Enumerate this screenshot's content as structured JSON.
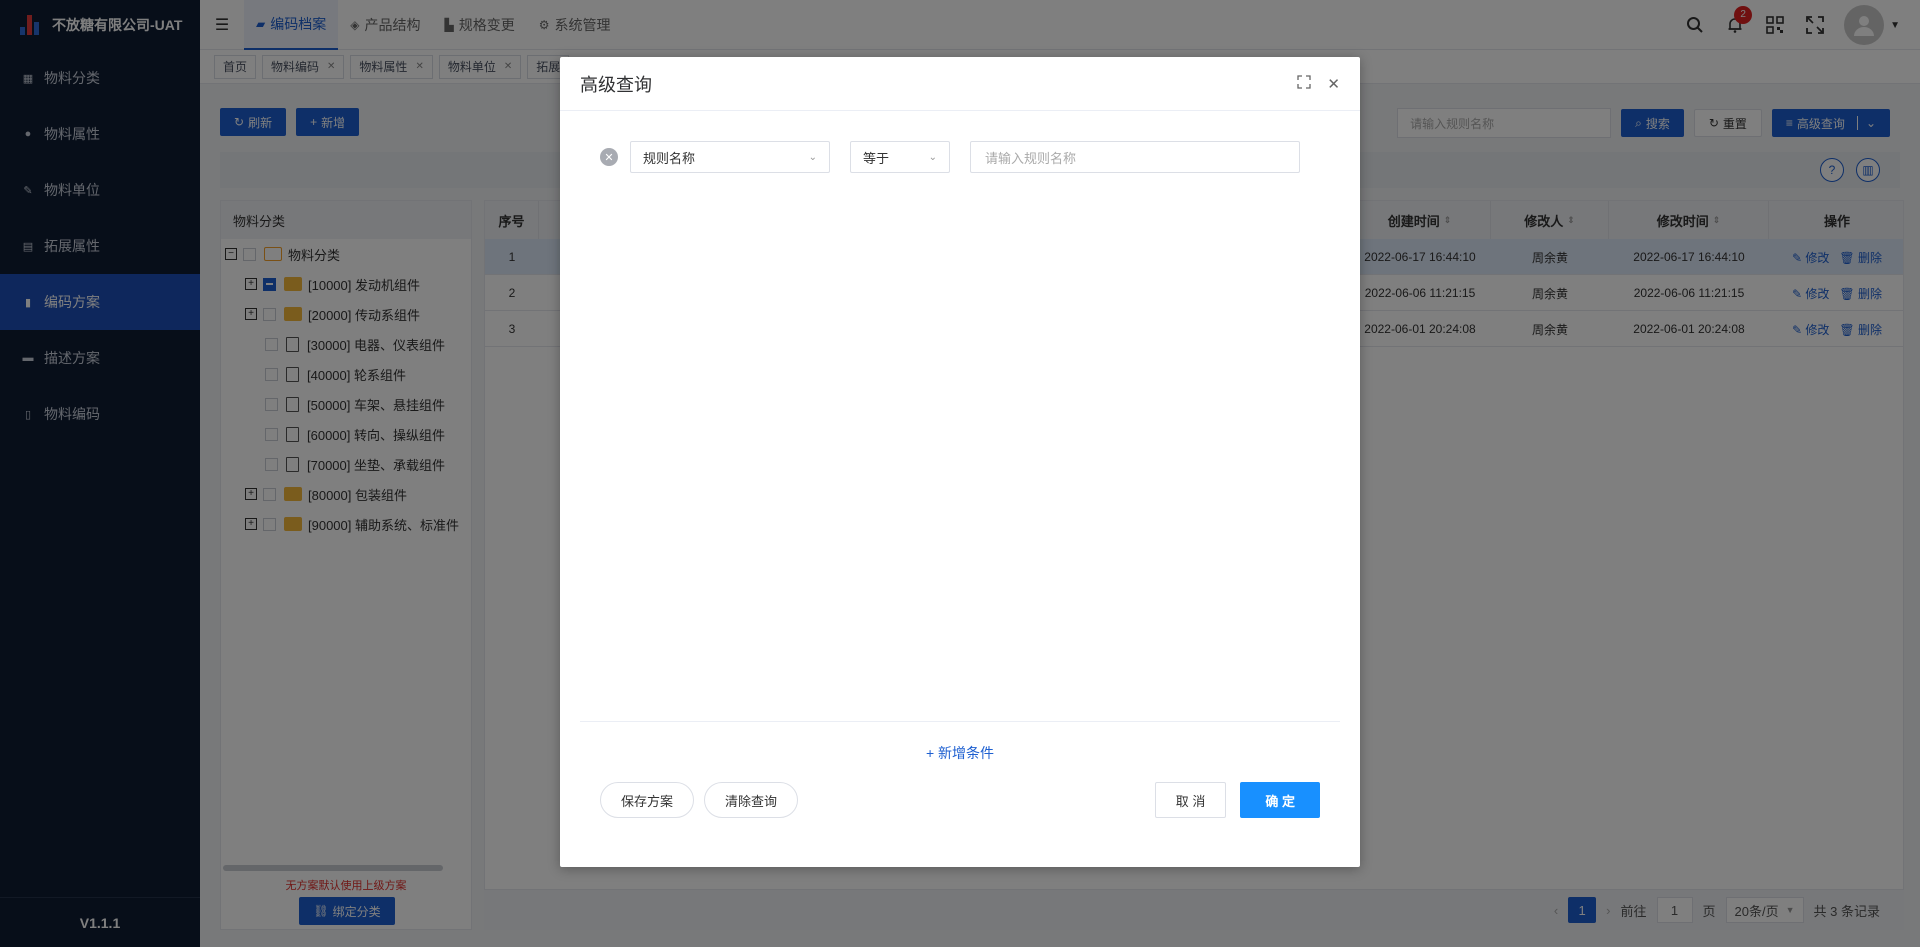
{
  "app": {
    "title": "不放糖有限公司-UAT",
    "version": "V1.1.1"
  },
  "sidebar": {
    "items": [
      {
        "label": "物料分类",
        "icon": "grid-icon"
      },
      {
        "label": "物料属性",
        "icon": "info-icon"
      },
      {
        "label": "物料单位",
        "icon": "ruler-icon"
      },
      {
        "label": "拓展属性",
        "icon": "table-icon"
      },
      {
        "label": "编码方案",
        "icon": "file-icon",
        "active": true
      },
      {
        "label": "描述方案",
        "icon": "book-icon"
      },
      {
        "label": "物料编码",
        "icon": "document-icon"
      }
    ]
  },
  "topnav": {
    "tabs": [
      {
        "label": "编码档案",
        "active": true
      },
      {
        "label": "产品结构"
      },
      {
        "label": "规格变更"
      },
      {
        "label": "系统管理"
      }
    ],
    "notification_count": "2"
  },
  "tags": [
    "首页",
    "物料编码",
    "物料属性",
    "物料单位",
    "拓展"
  ],
  "toolbar": {
    "refresh": "刷新",
    "add": "新增",
    "search_placeholder": "请输入规则名称",
    "search": "搜索",
    "reset": "重置",
    "advanced": "高级查询"
  },
  "tree": {
    "header": "物料分类",
    "root": "物料分类",
    "nodes": [
      {
        "label": "[10000] 发动机组件",
        "type": "folder",
        "expandable": true
      },
      {
        "label": "[20000] 传动系组件",
        "type": "folder",
        "expandable": true
      },
      {
        "label": "[30000] 电器、仪表组件",
        "type": "doc"
      },
      {
        "label": "[40000] 轮系组件",
        "type": "doc"
      },
      {
        "label": "[50000] 车架、悬挂组件",
        "type": "doc"
      },
      {
        "label": "[60000] 转向、操纵组件",
        "type": "doc"
      },
      {
        "label": "[70000] 坐垫、承载组件",
        "type": "doc"
      },
      {
        "label": "[80000] 包装组件",
        "type": "folder",
        "expandable": true
      },
      {
        "label": "[90000] 辅助系统、标准件",
        "type": "folder",
        "expandable": true
      }
    ],
    "note": "无方案默认使用上级方案",
    "bind_button": "绑定分类"
  },
  "grid": {
    "columns": {
      "index": "序号",
      "created": "创建时间",
      "modifier": "修改人",
      "modified": "修改时间",
      "actions": "操作"
    },
    "rows": [
      {
        "index": "1",
        "created": "2022-06-17 16:44:10",
        "modifier": "周余黄",
        "modified": "2022-06-17 16:44:10"
      },
      {
        "index": "2",
        "created": "2022-06-06 11:21:15",
        "modifier": "周余黄",
        "modified": "2022-06-06 11:21:15"
      },
      {
        "index": "3",
        "created": "2022-06-01 20:24:08",
        "modifier": "周余黄",
        "modified": "2022-06-01 20:24:08"
      }
    ],
    "edit": "修改",
    "delete": "删除"
  },
  "pager": {
    "current": "1",
    "goto": "前往",
    "page_input": "1",
    "page_unit": "页",
    "page_size": "20条/页",
    "total": "共 3 条记录"
  },
  "modal": {
    "title": "高级查询",
    "field_select": "规则名称",
    "operator_select": "等于",
    "value_placeholder": "请输入规则名称",
    "add_condition": "新增条件",
    "save_scheme": "保存方案",
    "clear_query": "清除查询",
    "cancel": "取 消",
    "confirm": "确 定"
  }
}
